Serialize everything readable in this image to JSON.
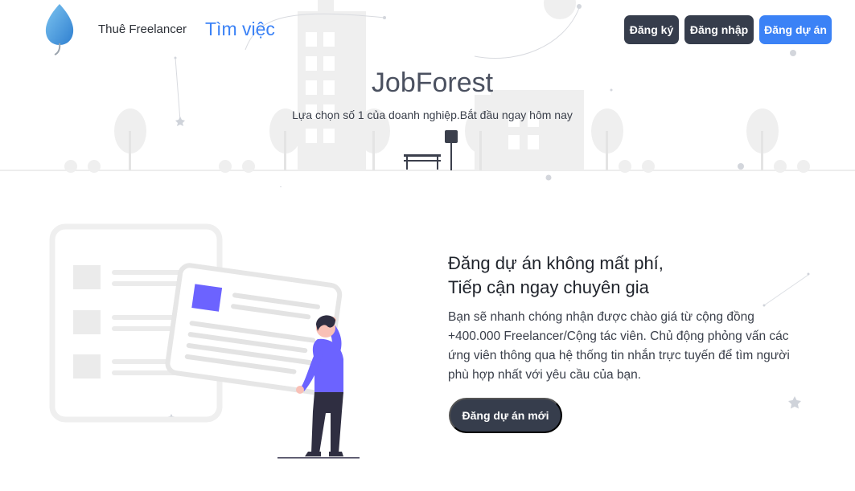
{
  "nav": {
    "hire_label": "Thuê Freelancer",
    "jobs_label": "Tìm việc"
  },
  "auth": {
    "register_label": "Đăng ký",
    "login_label": "Đăng nhập",
    "post_project_label": "Đăng dự án"
  },
  "hero": {
    "title": "JobForest",
    "subtitle": "Lựa chọn số 1 của doanh nghiệp.Bắt đầu ngay hôm nay"
  },
  "promo": {
    "title_line1": "Đăng dự án không mất phí,",
    "title_line2": "Tiếp cận ngay chuyên gia",
    "description": "Bạn sẽ nhanh chóng nhận được chào giá từ cộng đồng +400.000 Freelancer/Cộng tác viên. Chủ động phỏng vấn các ứng viên thông qua hệ thống tin nhắn trực tuyến để tìm người phù hợp nhất với yêu cầu của bạn.",
    "cta_label": "Đăng dự án mới"
  },
  "colors": {
    "primary": "#3b82f6",
    "dark_button": "#363d4c",
    "accent_purple": "#6c63ff"
  },
  "icons": {
    "logo": "leaf-logo-icon"
  }
}
